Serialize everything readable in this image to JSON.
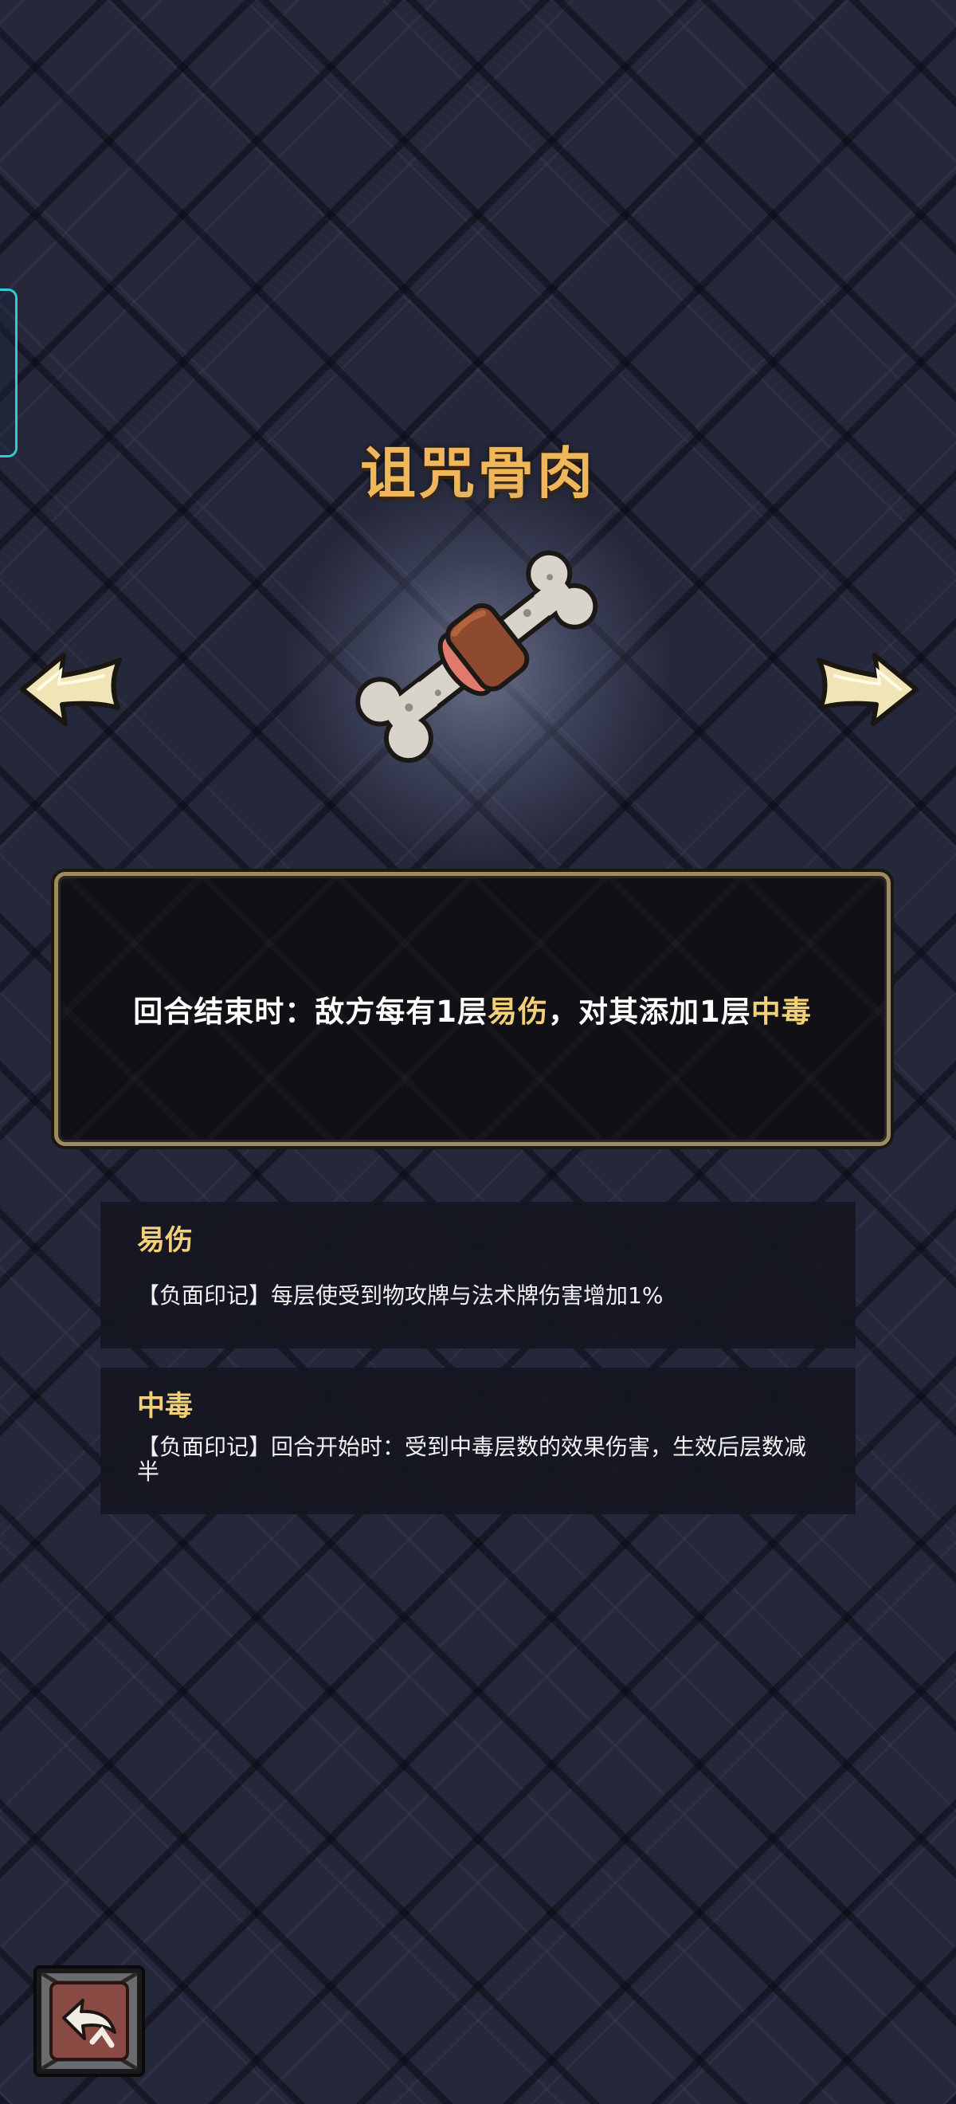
{
  "item": {
    "title": "诅咒骨肉",
    "icon": "cursed-bone-meat-icon",
    "description": {
      "part1": "回合结束时：敌方每有1层",
      "keyword1": "易伤",
      "part2": "，对其添加1层",
      "keyword2": "中毒"
    }
  },
  "keywords": [
    {
      "title": "易伤",
      "description": "【负面印记】每层使受到物攻牌与法术牌伤害增加1%"
    },
    {
      "title": "中毒",
      "description": "【负面印记】回合开始时：受到中毒层数的效果伤害，生效后层数减半"
    }
  ],
  "navigation": {
    "prev_icon": "arrow-left-icon",
    "next_icon": "arrow-right-icon",
    "back_icon": "return-arrow-icon"
  },
  "colors": {
    "title": "#f0b75a",
    "keyword": "#f2cf79",
    "accent_tab": "#37c6d6",
    "back_button": "#8a4a44"
  }
}
